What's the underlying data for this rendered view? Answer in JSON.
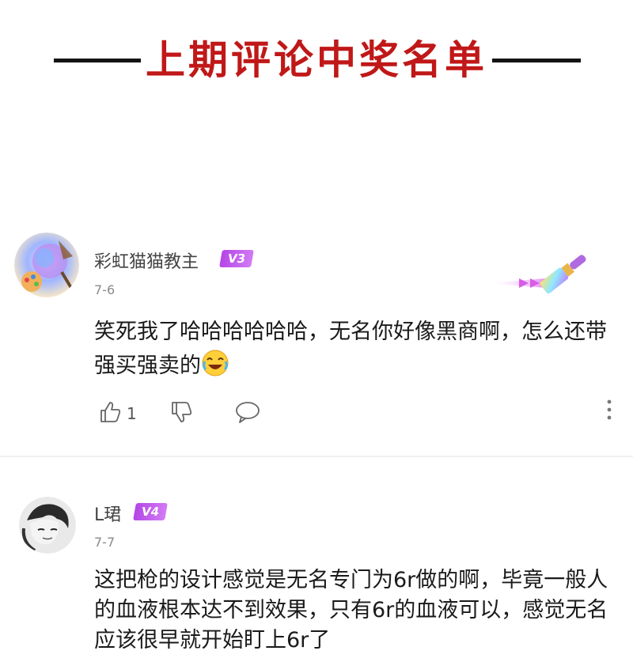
{
  "banner": {
    "title": "上期评论中奖名单"
  },
  "comments": [
    {
      "username": "彩虹猫猫教主",
      "level_badge": "V3",
      "date": "7-6",
      "text_before_emoji": "笑死我了哈哈哈哈哈哈，无名你好像黑商啊，怎么还带强买强卖的",
      "emoji": "laughing-crying-emoji",
      "like_count": "1",
      "icons": {
        "like": "thumbs-up-icon",
        "dislike": "thumbs-down-icon",
        "reply": "comment-bubble-icon",
        "more": "more-vertical-icon"
      }
    },
    {
      "username": "L珺",
      "level_badge": "V4",
      "date": "7-7",
      "text": "这把枪的设计感觉是无名专门为6r做的啊，毕竟一般人的血液根本达不到效果，只有6r的血液可以，感觉无名应该很早就开始盯上6r了"
    }
  ],
  "colors": {
    "banner_title": "#c01818",
    "badge": "#b445e6",
    "divider": "#f0f0f0"
  }
}
